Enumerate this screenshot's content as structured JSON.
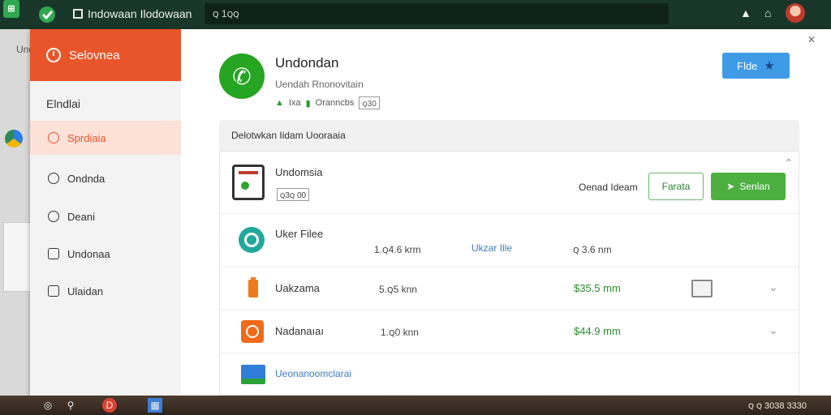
{
  "titlebar": {
    "title": "Indowaan Ilodowaan",
    "search_text": "ꞯ 1ꞯꞯ"
  },
  "desktop": {
    "left_text": "Undı"
  },
  "sidebar": {
    "header": "Selovnea",
    "section_label": "Elndlai",
    "items": [
      {
        "label": "Sprdiaia",
        "icon": "bag-icon"
      },
      {
        "label": "Ondnda",
        "icon": "chat-icon"
      },
      {
        "label": "Deani",
        "icon": "gauge-icon"
      },
      {
        "label": "Undonaa",
        "icon": "window-icon"
      },
      {
        "label": "Ulaidan",
        "icon": "panel-icon"
      }
    ]
  },
  "app": {
    "title": "Undondan",
    "subtitle": "Uendah Rnonovitain",
    "meta_a": "Ixa",
    "meta_b": "Oranncbs",
    "meta_c": "ꞯ30",
    "action_button": "Flde"
  },
  "section": {
    "title": "Delotwkan Iidam Uooraaia"
  },
  "featured": {
    "name": "Undomsia",
    "tag": "ꞯ3ꞯ 00",
    "info_text": "Oenad Ideam",
    "outline_button": "Farata",
    "green_button": "Senlan"
  },
  "rows": [
    {
      "name": "Uker Filee",
      "size": "1.ꞯ4.6 krm",
      "link": "Ukzar Ille",
      "price": "ꞯ 3.6 nm"
    },
    {
      "name": "Uakzama",
      "size": "5.ꞯ5 knn",
      "price": "$35.5 mm"
    },
    {
      "name": "Nadanaıaı",
      "size": "1.ꞯ0 knn",
      "price": "$44.9 mm"
    },
    {
      "name": "Ueonanoomclarai"
    }
  ],
  "taskbar": {
    "tray_text": "ꞯ ꞯ 3038 3330"
  },
  "colors": {
    "accent_orange": "#e9552a",
    "titlebar": "#18372a",
    "primary_green": "#4caf3f",
    "blue_button": "#3f9be6"
  }
}
